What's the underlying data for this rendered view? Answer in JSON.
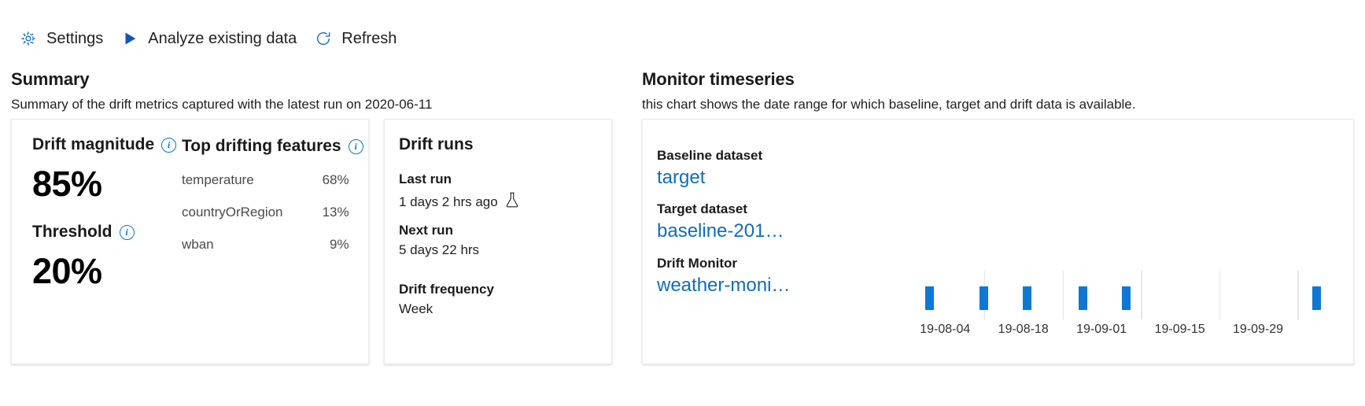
{
  "command_bar": {
    "buttons": [
      {
        "label": "Settings",
        "icon": "gear-icon",
        "name": "settings"
      },
      {
        "label": "Analyze existing data",
        "icon": "play-icon",
        "name": "analyze-existing-data"
      },
      {
        "label": "Refresh",
        "icon": "refresh-icon",
        "name": "refresh"
      }
    ]
  },
  "summary_section": {
    "title": "Summary",
    "subtitle": "Summary of the drift metrics captured with the latest run on 2020-06-11",
    "drift_magnitude": {
      "label": "Drift magnitude",
      "value": "85%",
      "info_icon": "info-icon"
    },
    "threshold": {
      "label": "Threshold",
      "value": "20%",
      "info_icon": "info-icon"
    },
    "top_drifting_features": {
      "label": "Top drifting features",
      "info_icon": "info-icon",
      "rows": [
        {
          "name": "temperature",
          "pct": "68%"
        },
        {
          "name": "countryOrRegion",
          "pct": "13%"
        },
        {
          "name": "wban",
          "pct": "9%"
        }
      ]
    }
  },
  "drift_runs": {
    "title": "Drift runs",
    "last_run_label": "Last run",
    "last_run_value": "1 days 2 hrs ago",
    "last_run_icon": "flask-icon",
    "next_run_label": "Next run",
    "next_run_value": "5 days 22 hrs",
    "frequency_label": "Drift frequency",
    "frequency_value": "Week"
  },
  "monitor_timeseries": {
    "title": "Monitor timeseries",
    "subtitle": "this chart shows the date range for which baseline, target and drift data is available.",
    "rows": [
      {
        "label": "Baseline dataset",
        "link": "target",
        "name": "baseline-dataset"
      },
      {
        "label": "Target dataset",
        "link": "baseline-201…",
        "name": "target-dataset"
      },
      {
        "label": "Drift Monitor",
        "link": "weather-moni…",
        "name": "drift-monitor"
      }
    ]
  },
  "chart_data": {
    "type": "bar",
    "title": "Monitor timeseries",
    "xlabel": "",
    "ylabel": "",
    "grid": true,
    "legend": "none",
    "tick_labels": [
      "19-08-04",
      "19-08-18",
      "19-09-01",
      "19-09-15",
      "19-09-29"
    ],
    "tick_positions_pct": [
      22.5,
      37.8,
      53.1,
      68.4,
      83.7
    ],
    "gridline_positions_pct": [
      30.1,
      45.5,
      60.8,
      76.1,
      91.4
    ],
    "bars": [
      {
        "x_pct": 19.5,
        "value": 1
      },
      {
        "x_pct": 30.1,
        "value": 1
      },
      {
        "x_pct": 38.6,
        "value": 1
      },
      {
        "x_pct": 49.4,
        "value": 1
      },
      {
        "x_pct": 57.9,
        "value": 1
      },
      {
        "x_pct": 95.2,
        "value": 1
      }
    ],
    "bar_color": "#0f78d4"
  },
  "colors": {
    "accent": "#0078d4",
    "link": "#0f6cbd",
    "bar": "#0f78d4",
    "card_border": "#edebe9",
    "grid": "#e6e6e6"
  }
}
